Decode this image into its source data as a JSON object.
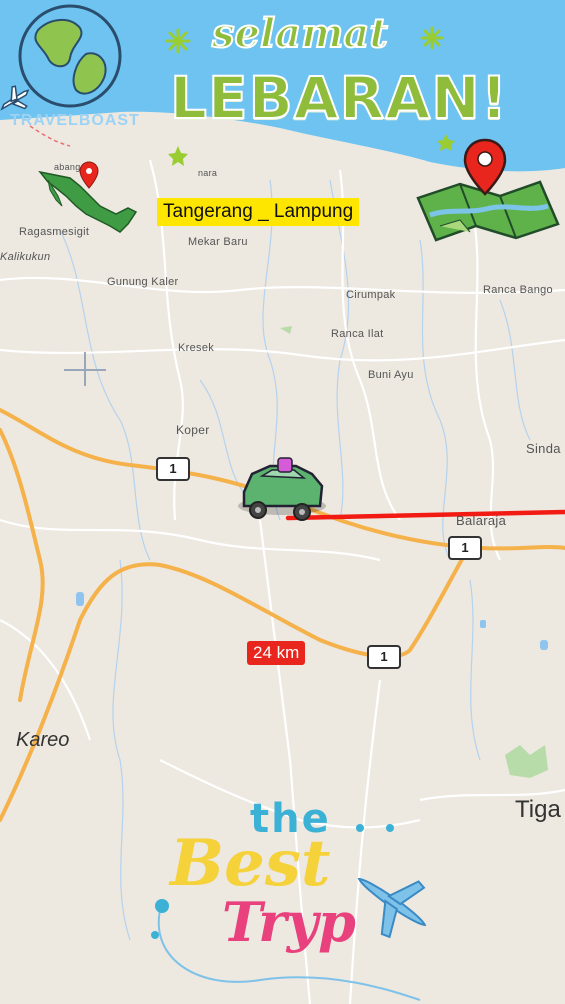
{
  "greeting": {
    "small": "selamat",
    "big": "LEBARAN!"
  },
  "brand": "TRAVELBOAST",
  "route_title": "Tangerang _ Lampung",
  "distance_label": "24 km",
  "highway_number": "1",
  "places": {
    "ragasmesigit": "Ragasmesigit",
    "kalikukun": "Kalikukun",
    "mekar_baru": "Mekar Baru",
    "gunung_kaler": "Gunung Kaler",
    "cirumpak": "Cirumpak",
    "ranca_bango": "Ranca Bango",
    "kresek": "Kresek",
    "ranca_ilat": "Ranca Ilat",
    "buni_ayu": "Buni Ayu",
    "koper": "Koper",
    "sinda": "Sinda",
    "balaraja": "Balaraja",
    "kareo": "Kareo",
    "tiga": "Tiga",
    "cabang": "abang",
    "nara": "nara"
  },
  "sticker": {
    "the": "the",
    "best": "Best",
    "trip": "Tryp"
  },
  "colors": {
    "sea": "#6ec3f0",
    "land": "#ede8e0",
    "route": "#f21b13",
    "highway": "#f5b14a",
    "river": "#a8d0f0",
    "highlight": "#ffe600",
    "distance_bg": "#e8261d"
  }
}
